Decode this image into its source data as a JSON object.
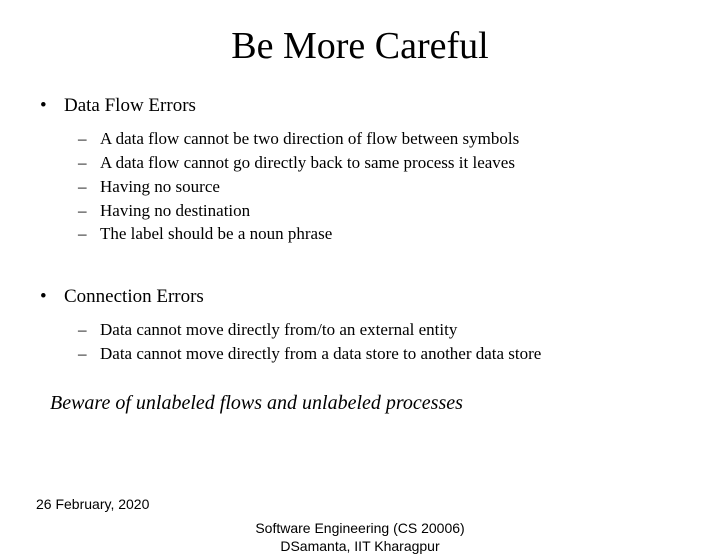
{
  "title": "Be More Careful",
  "sections": [
    {
      "heading": "Data Flow Errors",
      "items": [
        "A data flow cannot be two direction of flow between symbols",
        "A data flow cannot go directly back to same process it leaves",
        "Having no source",
        "Having no destination",
        "The label should be a noun phrase"
      ]
    },
    {
      "heading": "Connection Errors",
      "items": [
        "Data cannot move directly from/to an external entity",
        "Data cannot move directly from  a data store to another data store"
      ]
    }
  ],
  "beware": "Beware of unlabeled flows and unlabeled processes",
  "footer": {
    "date": "26 February, 2020",
    "course_line1": "Software Engineering (CS 20006)",
    "course_line2": "DSamanta, IIT Kharagpur"
  }
}
